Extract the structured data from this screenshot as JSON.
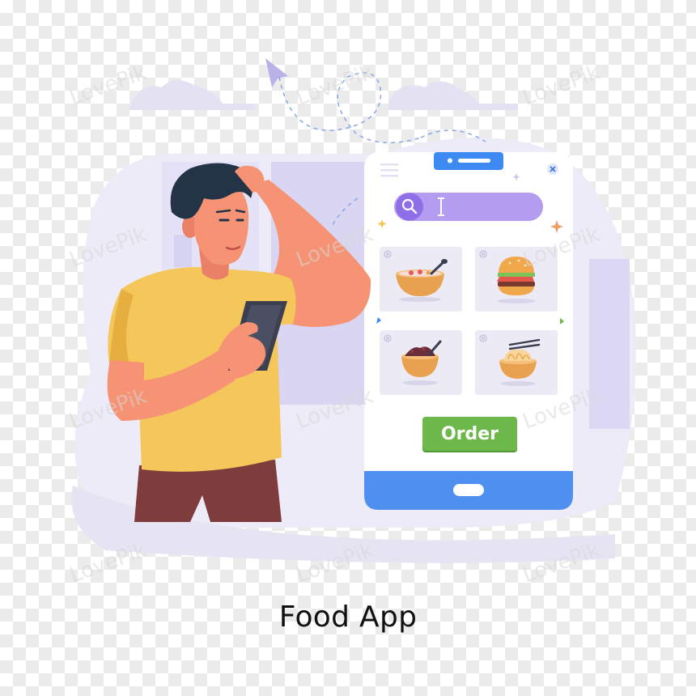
{
  "order_button": {
    "label": "Order"
  },
  "caption": {
    "text": "Food App"
  },
  "search_bar": {
    "icon": "search-icon",
    "cursor": "I"
  },
  "food_cards": [
    {
      "name": "soup bowl",
      "icon": "soup-bowl-icon"
    },
    {
      "name": "burger",
      "icon": "burger-icon"
    },
    {
      "name": "rice bowl",
      "icon": "rice-bowl-icon"
    },
    {
      "name": "noodle bowl",
      "icon": "noodle-bowl-icon"
    }
  ],
  "watermark": "LovePik",
  "colors": {
    "phone_header": "#3d8bf2",
    "phone_footer": "#4f8ff0",
    "search_bar": "#b49cf0",
    "order_button": "#6cb84a",
    "shirt": "#f5c65a",
    "pants": "#7e3c3c",
    "skin": "#f59374",
    "hair": "#243447"
  }
}
